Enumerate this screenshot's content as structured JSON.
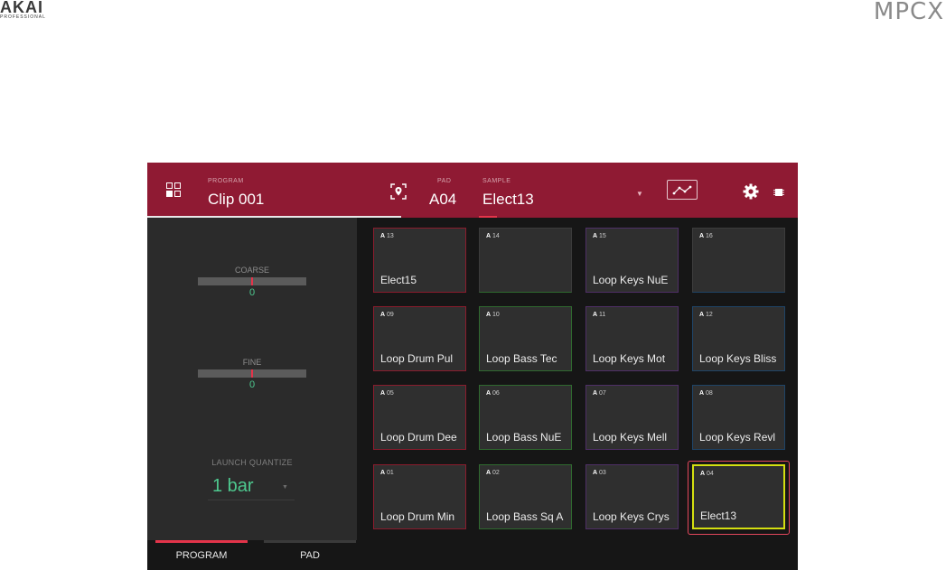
{
  "brand": {
    "left_logo": "AKAI",
    "left_sub": "PROFESSIONAL",
    "right_logo": "MPCX"
  },
  "header": {
    "program_label": "PROGRAM",
    "program_value": "Clip 001",
    "pad_label": "PAD",
    "pad_value": "A04",
    "sample_label": "SAMPLE",
    "sample_value": "Elect13"
  },
  "left_panel": {
    "coarse": {
      "label": "COARSE",
      "value": "0"
    },
    "fine": {
      "label": "FINE",
      "value": "0"
    },
    "launch_quantize": {
      "label": "LAUNCH QUANTIZE",
      "value": "1 bar"
    }
  },
  "pads": [
    {
      "bank": "A",
      "num": "13",
      "name": "Elect15",
      "color": "#8b1c2d"
    },
    {
      "bank": "A",
      "num": "14",
      "name": "",
      "color": "#2f6a2f"
    },
    {
      "bank": "A",
      "num": "15",
      "name": "Loop Keys NuE",
      "color": "#4f2f67"
    },
    {
      "bank": "A",
      "num": "16",
      "name": "",
      "color": "#1f4467"
    },
    {
      "bank": "A",
      "num": "09",
      "name": "Loop Drum Pul",
      "color": "#8b1c2d"
    },
    {
      "bank": "A",
      "num": "10",
      "name": "Loop Bass Tec",
      "color": "#2f6a2f"
    },
    {
      "bank": "A",
      "num": "11",
      "name": "Loop Keys Mot",
      "color": "#4f2f67"
    },
    {
      "bank": "A",
      "num": "12",
      "name": "Loop Keys Bliss",
      "color": "#1f4467"
    },
    {
      "bank": "A",
      "num": "05",
      "name": "Loop Drum Dee",
      "color": "#8b1c2d"
    },
    {
      "bank": "A",
      "num": "06",
      "name": "Loop Bass NuE",
      "color": "#2f6a2f"
    },
    {
      "bank": "A",
      "num": "07",
      "name": "Loop Keys Mell",
      "color": "#4f2f67"
    },
    {
      "bank": "A",
      "num": "08",
      "name": "Loop Keys Revl",
      "color": "#1f4467"
    },
    {
      "bank": "A",
      "num": "01",
      "name": "Loop Drum Min",
      "color": "#8b1c2d"
    },
    {
      "bank": "A",
      "num": "02",
      "name": "Loop Bass Sq A",
      "color": "#2f6a2f"
    },
    {
      "bank": "A",
      "num": "03",
      "name": "Loop Keys Crys",
      "color": "#4f2f67"
    },
    {
      "bank": "A",
      "num": "04",
      "name": "Elect13",
      "color": "#d4df10"
    }
  ],
  "tabs": [
    {
      "label": "PROGRAM",
      "active": true
    },
    {
      "label": "PAD",
      "active": false
    }
  ],
  "colors": {
    "header": "#8f1a33",
    "accent_green": "#4ec98f",
    "selected_pad": "#d4df10",
    "selection_ring": "#e2475c"
  },
  "icons": [
    "pad-grid-icon",
    "location-pin-icon",
    "envelope-curve-icon",
    "gear-icon",
    "chip-icon"
  ]
}
